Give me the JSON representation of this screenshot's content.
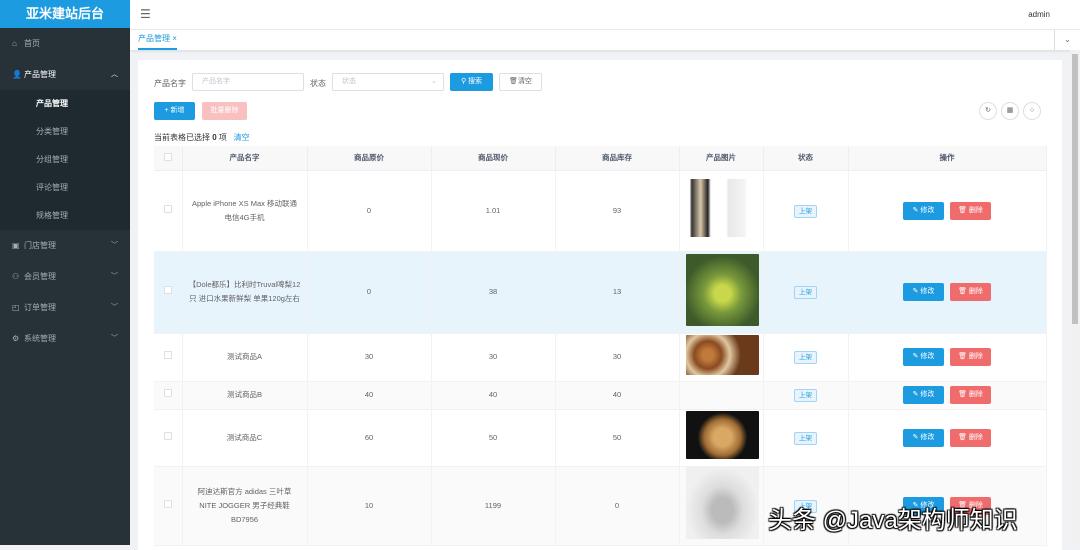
{
  "app": {
    "title": "亚米建站后台",
    "user": "admin"
  },
  "sidebar": {
    "items": [
      {
        "label": "首页",
        "icon": "home-icon"
      },
      {
        "label": "产品管理",
        "icon": "user-icon",
        "open": true,
        "children": [
          "产品管理",
          "分类管理",
          "分组管理",
          "评论管理",
          "规格管理"
        ]
      },
      {
        "label": "门店管理",
        "icon": "store-icon"
      },
      {
        "label": "会员管理",
        "icon": "members-icon"
      },
      {
        "label": "订单管理",
        "icon": "order-icon"
      },
      {
        "label": "系统管理",
        "icon": "gear-icon"
      }
    ]
  },
  "tabs": [
    {
      "label": "产品管理",
      "close": "×"
    }
  ],
  "filter": {
    "name_label": "产品名字",
    "name_placeholder": "产品名字",
    "status_label": "状态",
    "status_placeholder": "状态",
    "search": "搜索",
    "clear": "清空"
  },
  "toolbar": {
    "add": "+ 新增",
    "batch_delete": "批量删除"
  },
  "selection": {
    "prefix": "当前表格已选择",
    "count": "0",
    "suffix": "项",
    "clear": "清空"
  },
  "table": {
    "headers": [
      "产品名字",
      "商品原价",
      "商品现价",
      "商品库存",
      "产品图片",
      "状态",
      "操作"
    ],
    "rows": [
      {
        "name": "Apple iPhone XS Max 移动联通电信4G手机",
        "orig": "0",
        "price": "1.01",
        "stock": "93",
        "status": "上架"
      },
      {
        "name": "【Dole都乐】比利时Truval啤梨12只 进口水果新鲜梨 单果120g左右",
        "orig": "0",
        "price": "38",
        "stock": "13",
        "status": "上架"
      },
      {
        "name": "测试商品A",
        "orig": "30",
        "price": "30",
        "stock": "30",
        "status": "上架"
      },
      {
        "name": "测试商品B",
        "orig": "40",
        "price": "40",
        "stock": "40",
        "status": "上架"
      },
      {
        "name": "测试商品C",
        "orig": "60",
        "price": "50",
        "stock": "50",
        "status": "上架"
      },
      {
        "name": "阿迪达斯官方 adidas 三叶草 NITE JOGGER 男子经典鞋BD7956",
        "orig": "10",
        "price": "1199",
        "stock": "0",
        "status": "上架"
      }
    ],
    "edit": "修改",
    "delete": "删除"
  },
  "watermark": "头条 @Java架构师知识"
}
